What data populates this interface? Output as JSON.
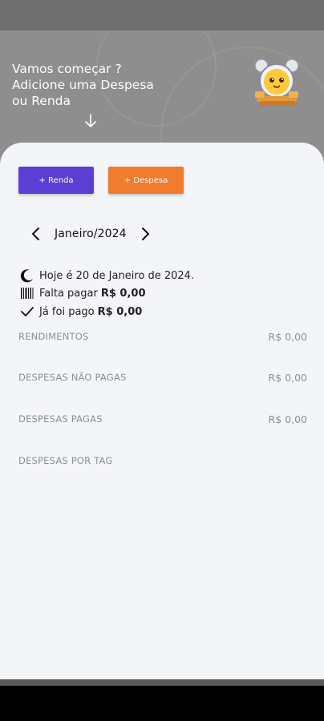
{
  "hero": {
    "line1": "Vamos começar ?",
    "line2": "Adicione uma Despesa",
    "line3": "ou Renda"
  },
  "actions": {
    "renda_label": "+ Renda",
    "despesa_label": "+ Despesa"
  },
  "month": {
    "label": "Janeiro/2024"
  },
  "info": {
    "today": "Hoje é 20 de Janeiro de 2024.",
    "to_pay_label": "Falta pagar",
    "to_pay_value": "R$ 0,00",
    "paid_label": "Já foi pago",
    "paid_value": "R$ 0,00"
  },
  "sections": [
    {
      "title": "RENDIMENTOS",
      "value": "R$ 0,00"
    },
    {
      "title": "DESPESAS NÃO PAGAS",
      "value": "R$ 0,00"
    },
    {
      "title": "DESPESAS PAGAS",
      "value": "R$ 0,00"
    },
    {
      "title": "DESPESAS POR TAG",
      "value": ""
    }
  ],
  "colors": {
    "renda_button": "#5b3fd4",
    "despesa_button": "#f07c2e",
    "sheet_background": "#f4f5f8"
  },
  "icons": [
    "down-arrow-icon",
    "chevron-left-icon",
    "chevron-right-icon",
    "moon-icon",
    "barcode-icon",
    "check-icon",
    "mascot-clock-icon"
  ]
}
